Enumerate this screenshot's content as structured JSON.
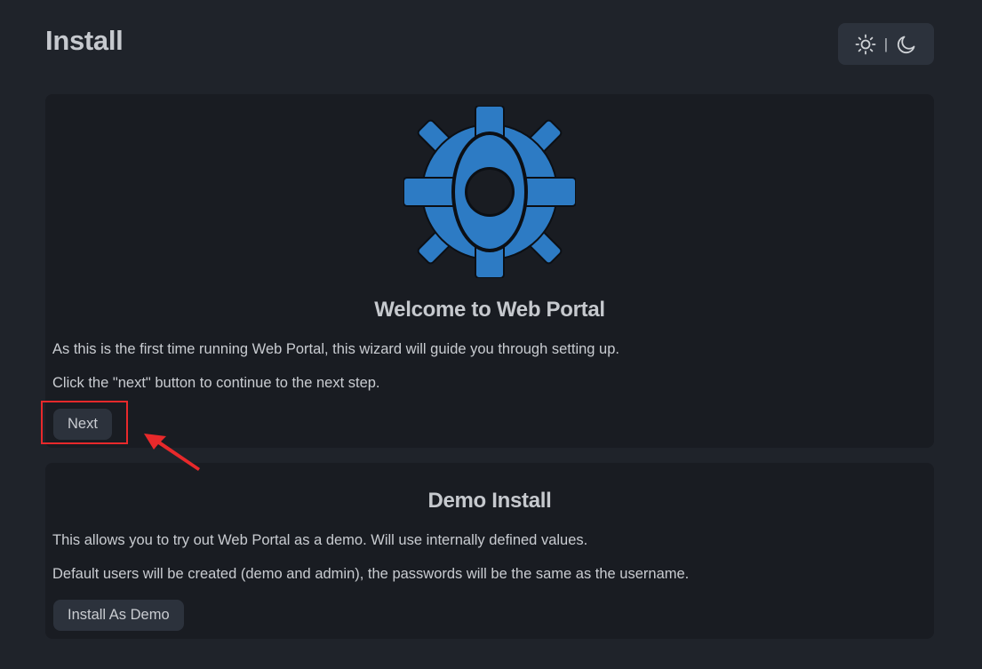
{
  "page": {
    "title": "Install"
  },
  "theme_toggle": {
    "light_icon": "sun-icon",
    "separator": "|",
    "dark_icon": "moon-icon"
  },
  "welcome": {
    "logo_icon": "web-portal-logo",
    "heading": "Welcome to Web Portal",
    "paragraph_1": "As this is the first time running Web Portal, this wizard will guide you through setting up.",
    "paragraph_2": "Click the \"next\" button to continue to the next step.",
    "next_button": "Next"
  },
  "demo": {
    "heading": "Demo Install",
    "paragraph_1": "This allows you to try out Web Portal as a demo. Will use internally defined values.",
    "paragraph_2": "Default users will be created (demo and admin), the passwords will be the same as the username.",
    "install_button": "Install As Demo"
  },
  "colors": {
    "background": "#1f232a",
    "card": "#191c22",
    "button": "#2c323c",
    "logo_blue": "#2d7bc4",
    "annotation_red": "#e8292b"
  }
}
